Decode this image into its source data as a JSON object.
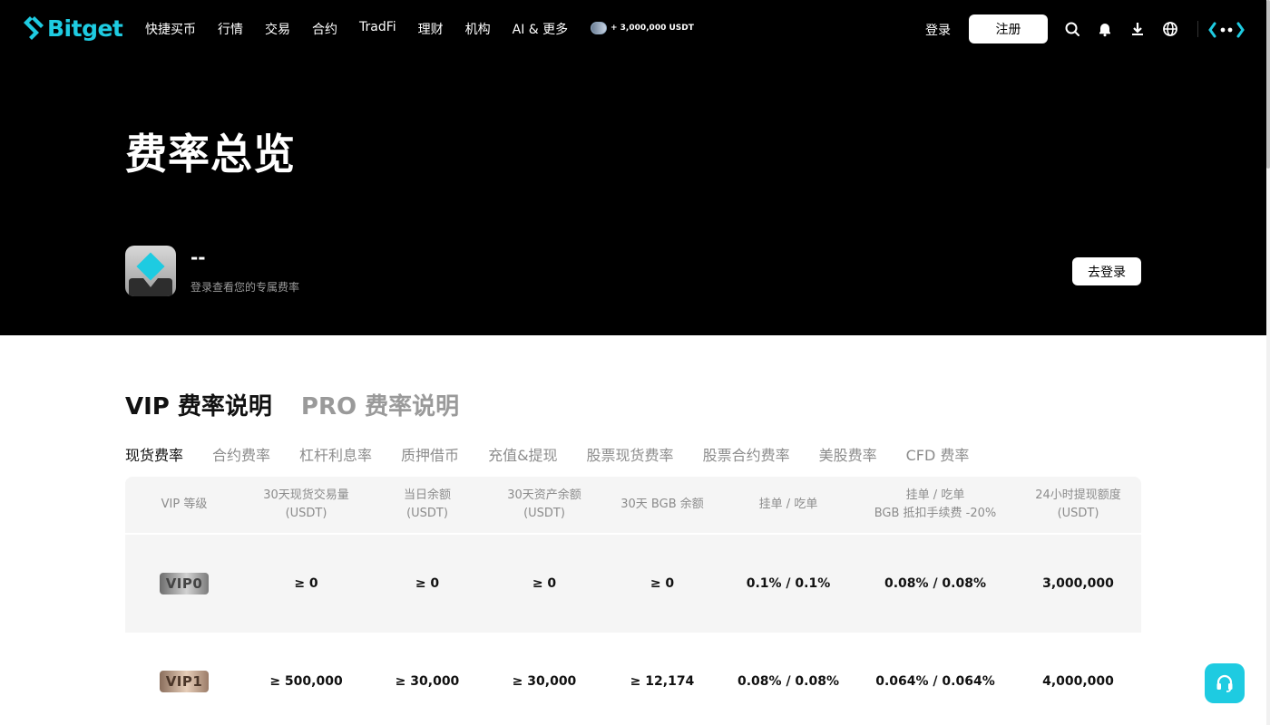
{
  "header": {
    "brand": "Bitget",
    "nav": [
      "快捷买币",
      "行情",
      "交易",
      "合约",
      "TradFi",
      "理财",
      "机构",
      "AI & 更多"
    ],
    "promo_text": "+ 3,000,000 USDT",
    "login_label": "登录",
    "register_label": "注册",
    "icons": [
      "search-icon",
      "bell-icon",
      "download-icon",
      "globe-icon",
      "ai-assistant-icon"
    ]
  },
  "hero": {
    "title": "费率总览",
    "user_name": "--",
    "user_hint": "登录查看您的专属费率",
    "login_button": "去登录"
  },
  "section_tabs": [
    {
      "label": "VIP 费率说明",
      "active": true
    },
    {
      "label": "PRO 费率说明",
      "active": false
    }
  ],
  "sub_tabs": [
    {
      "label": "现货费率",
      "active": true
    },
    {
      "label": "合约费率",
      "active": false
    },
    {
      "label": "杠杆利息率",
      "active": false
    },
    {
      "label": "质押借币",
      "active": false
    },
    {
      "label": "充值&提现",
      "active": false
    },
    {
      "label": "股票现货费率",
      "active": false
    },
    {
      "label": "股票合约费率",
      "active": false
    },
    {
      "label": "美股费率",
      "active": false
    },
    {
      "label": "CFD 费率",
      "active": false
    }
  ],
  "table": {
    "headers": [
      {
        "line1": "VIP 等级",
        "line2": ""
      },
      {
        "line1": "30天现货交易量",
        "line2": "(USDT)"
      },
      {
        "line1": "当日余额",
        "line2": "(USDT)"
      },
      {
        "line1": "30天资产余额",
        "line2": "(USDT)"
      },
      {
        "line1": "30天 BGB 余额",
        "line2": ""
      },
      {
        "line1": "挂单 / 吃单",
        "line2": ""
      },
      {
        "line1": "挂单 / 吃单",
        "line2": "BGB 抵扣手续费 -20%"
      },
      {
        "line1": "24小时提现额度",
        "line2": "(USDT)"
      }
    ],
    "rows": [
      {
        "level": "VIP0",
        "volume": "≥ 0",
        "daily_balance": "≥ 0",
        "asset_balance": "≥ 0",
        "bgb_balance": "≥ 0",
        "maker_taker": "0.1% / 0.1%",
        "maker_taker_bgb": "0.08% / 0.08%",
        "withdraw_limit": "3,000,000"
      },
      {
        "level": "VIP1",
        "volume": "≥ 500,000",
        "daily_balance": "≥ 30,000",
        "asset_balance": "≥ 30,000",
        "bgb_balance": "≥ 12,174",
        "maker_taker": "0.08% / 0.08%",
        "maker_taker_bgb": "0.064% / 0.064%",
        "withdraw_limit": "4,000,000"
      }
    ]
  },
  "colors": {
    "brand": "#1ecbe1",
    "header_bg": "#000000",
    "table_header_bg": "#f5f5f5"
  }
}
